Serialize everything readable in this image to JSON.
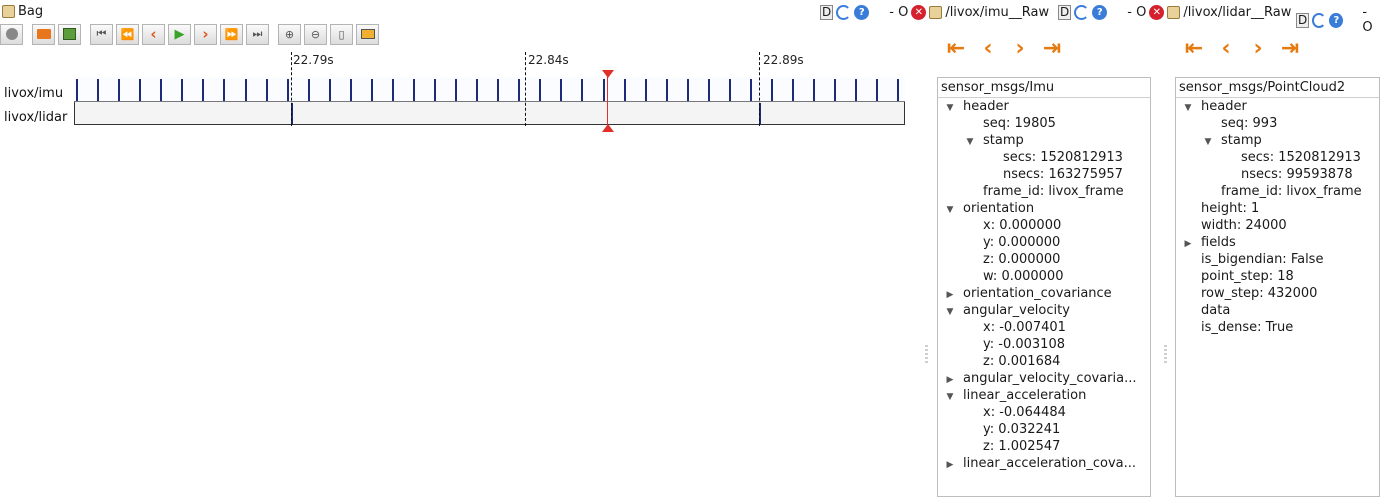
{
  "window": {
    "title": "Bag"
  },
  "toolbar": {
    "buttons": [
      "record-button",
      "open-button",
      "save-button",
      "begin-button",
      "back-button",
      "prev-button",
      "play-button",
      "next-button",
      "forward-button",
      "end-button",
      "zoom-in-button",
      "zoom-out-button",
      "zoom-reset-button",
      "thumbnail-button"
    ]
  },
  "timeline": {
    "ticks": [
      {
        "label": "22.79s",
        "value": 22.79
      },
      {
        "label": "22.84s",
        "value": 22.84
      },
      {
        "label": "22.89s",
        "value": 22.89
      }
    ],
    "playhead": 22.858,
    "topics": [
      {
        "name": "livox/imu"
      },
      {
        "name": "livox/lidar"
      }
    ],
    "imu_messages": "periodic",
    "lidar_messages": "periodic"
  },
  "panes": [
    {
      "header": {
        "prefix": "- O",
        "topic": "/livox/imu__Raw",
        "dock": "D"
      },
      "type": "sensor_msgs/Imu",
      "rows": [
        {
          "indent": 0,
          "caret": "open",
          "key": "header",
          "val": ""
        },
        {
          "indent": 1,
          "caret": "",
          "key": "seq:",
          "val": " 19805"
        },
        {
          "indent": 1,
          "caret": "open",
          "key": "stamp",
          "val": ""
        },
        {
          "indent": 2,
          "caret": "",
          "key": "secs:",
          "val": " 1520812913"
        },
        {
          "indent": 2,
          "caret": "",
          "key": "nsecs:",
          "val": " 163275957"
        },
        {
          "indent": 1,
          "caret": "",
          "key": "frame_id:",
          "val": " livox_frame"
        },
        {
          "indent": 0,
          "caret": "open",
          "key": "orientation",
          "val": ""
        },
        {
          "indent": 1,
          "caret": "",
          "key": "x:",
          "val": " 0.000000"
        },
        {
          "indent": 1,
          "caret": "",
          "key": "y:",
          "val": " 0.000000"
        },
        {
          "indent": 1,
          "caret": "",
          "key": "z:",
          "val": " 0.000000"
        },
        {
          "indent": 1,
          "caret": "",
          "key": "w:",
          "val": " 0.000000"
        },
        {
          "indent": 0,
          "caret": "closed",
          "key": "orientation_covariance",
          "val": ""
        },
        {
          "indent": 0,
          "caret": "open",
          "key": "angular_velocity",
          "val": ""
        },
        {
          "indent": 1,
          "caret": "",
          "key": "x:",
          "val": " -0.007401"
        },
        {
          "indent": 1,
          "caret": "",
          "key": "y:",
          "val": " -0.003108"
        },
        {
          "indent": 1,
          "caret": "",
          "key": "z:",
          "val": " 0.001684"
        },
        {
          "indent": 0,
          "caret": "closed",
          "key": "angular_velocity_covaria...",
          "val": ""
        },
        {
          "indent": 0,
          "caret": "open",
          "key": "linear_acceleration",
          "val": ""
        },
        {
          "indent": 1,
          "caret": "",
          "key": "x:",
          "val": " -0.064484"
        },
        {
          "indent": 1,
          "caret": "",
          "key": "y:",
          "val": " 0.032241"
        },
        {
          "indent": 1,
          "caret": "",
          "key": "z:",
          "val": " 1.002547"
        },
        {
          "indent": 0,
          "caret": "closed",
          "key": "linear_acceleration_cova...",
          "val": ""
        }
      ]
    },
    {
      "header": {
        "prefix": "- O",
        "topic": "/livox/lidar__Raw",
        "dock": "D"
      },
      "type": "sensor_msgs/PointCloud2",
      "rows": [
        {
          "indent": 0,
          "caret": "open",
          "key": "header",
          "val": ""
        },
        {
          "indent": 1,
          "caret": "",
          "key": "seq:",
          "val": " 993"
        },
        {
          "indent": 1,
          "caret": "open",
          "key": "stamp",
          "val": ""
        },
        {
          "indent": 2,
          "caret": "",
          "key": "secs:",
          "val": " 1520812913"
        },
        {
          "indent": 2,
          "caret": "",
          "key": "nsecs:",
          "val": " 99593878"
        },
        {
          "indent": 1,
          "caret": "",
          "key": "frame_id:",
          "val": " livox_frame"
        },
        {
          "indent": 0,
          "caret": "",
          "key": "height:",
          "val": " 1"
        },
        {
          "indent": 0,
          "caret": "",
          "key": "width:",
          "val": " 24000"
        },
        {
          "indent": 0,
          "caret": "closed",
          "key": "fields",
          "val": ""
        },
        {
          "indent": 0,
          "caret": "",
          "key": "is_bigendian:",
          "val": " False"
        },
        {
          "indent": 0,
          "caret": "",
          "key": "point_step:",
          "val": " 18"
        },
        {
          "indent": 0,
          "caret": "",
          "key": "row_step:",
          "val": " 432000"
        },
        {
          "indent": 0,
          "caret": "",
          "key": "data",
          "val": ""
        },
        {
          "indent": 0,
          "caret": "",
          "key": "is_dense:",
          "val": " True"
        }
      ]
    }
  ],
  "third_pane_prefix": "- O",
  "colors": {
    "accent_arrow": "#e47a10",
    "marker": "#1d2a78",
    "playhead": "#e0302a"
  }
}
